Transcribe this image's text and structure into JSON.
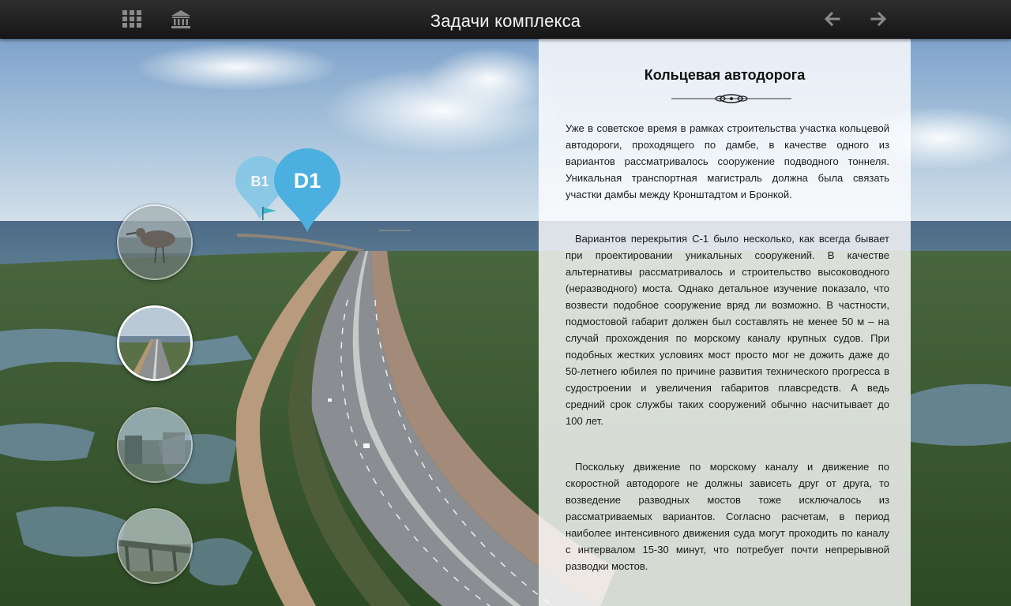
{
  "header": {
    "title": "Задачи комплекса"
  },
  "icons": {
    "menu": "grid-icon",
    "home": "museum-icon",
    "back": "arrow-left-icon",
    "forward": "arrow-right-icon"
  },
  "map": {
    "pins": [
      {
        "label": "B1",
        "color": "#7ec6e6"
      },
      {
        "label": "D1",
        "color": "#4bb0df"
      }
    ]
  },
  "article": {
    "title": "Кольцевая автодорога",
    "paragraphs": [
      "Уже в советское время в рамках строительства участка кольцевой автодороги, проходящего по дамбе, в качестве одного из вариантов рассматривалось сооружение подводного тоннеля. Уникальная транспортная магистраль должна была связать участки дамбы между Кронштадтом и Бронкой.",
      "Вариантов перекрытия С-1 было несколько, как всегда бывает при проектировании уникальных сооружений. В качестве альтернативы рассматривалось и строительство высоководного (неразводного) моста. Однако детальное изучение показало, что возвести подобное сооружение вряд ли возможно. В частности, подмостовой габарит должен был составлять не менее 50 м – на случай прохождения по морскому каналу крупных судов. При подобных жестких условиях мост просто мог не дожить даже до 50-летнего юбилея по причине развития технического прогресса в судостроении и увеличения габаритов плавсредств. А ведь средний срок службы таких сооружений обычно насчитывает до 100 лет.",
      "Поскольку движение по морскому каналу и движение по скоростной автодороге не должны зависеть друг от друга, то возведение разводных мостов тоже исключалось из рассматриваемых вариантов. Согласно расчетам, в период наиболее интенсивного движения суда могут проходить по каналу с интервалом 15-30 минут, что потребует почти непрерывной разводки мостов."
    ]
  },
  "gallery": {
    "active_index": 1,
    "items": [
      "bird-photo",
      "dam-road-photo",
      "construction-photo",
      "bridge-photo"
    ]
  }
}
